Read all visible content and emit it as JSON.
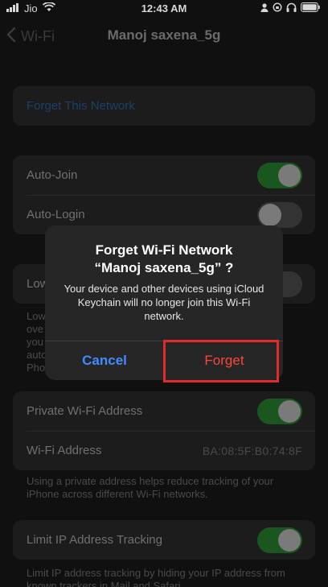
{
  "status": {
    "carrier": "Jio",
    "time": "12:43 AM",
    "icons": [
      "signal-icon",
      "wifi-icon",
      "person-icon",
      "lock-rotation-icon",
      "headphones-icon",
      "battery-icon"
    ]
  },
  "nav": {
    "back_label": "Wi-Fi",
    "title": "Manoj saxena_5g"
  },
  "forget_row": {
    "label": "Forget This Network"
  },
  "join_group": {
    "auto_join": {
      "label": "Auto-Join",
      "state": "on"
    },
    "auto_login": {
      "label": "Auto-Login",
      "state": "off"
    }
  },
  "low_data": {
    "label_visible": "Low",
    "footnote_fragments": [
      "Low",
      "ove",
      "you",
      "auto",
      "Pho"
    ]
  },
  "privacy_group": {
    "private_address": {
      "label": "Private Wi-Fi Address",
      "state": "on"
    },
    "wifi_address": {
      "label": "Wi-Fi Address",
      "value": "BA:08:5F:B0:74:8F"
    }
  },
  "privacy_footnote": "Using a private address helps reduce tracking of your iPhone across different Wi-Fi networks.",
  "limit_tracking": {
    "label": "Limit IP Address Tracking",
    "state": "on"
  },
  "limit_footnote": "Limit IP address tracking by hiding your IP address from known trackers in Mail and Safari.",
  "alert": {
    "title_line1": "Forget Wi-Fi Network",
    "title_line2": "“Manoj saxena_5g” ?",
    "message": "Your device and other devices using iCloud Keychain will no longer join this Wi-Fi network.",
    "cancel_label": "Cancel",
    "forget_label": "Forget"
  },
  "colors": {
    "alert_cancel": "#3f8cff",
    "alert_forget": "#ff453a",
    "highlight_box": "#e32a2a",
    "toggle_on": "#19571f"
  }
}
